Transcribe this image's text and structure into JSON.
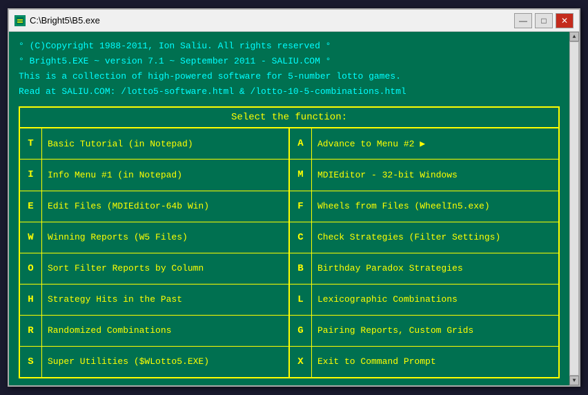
{
  "window": {
    "title": "C:\\Bright5\\B5.exe"
  },
  "titlebar": {
    "minimize": "—",
    "maximize": "□",
    "close": "✕"
  },
  "header": {
    "line1": "° (C)Copyright 1988-2011, Ion Saliu. All rights reserved °",
    "line2": "° Bright5.EXE ~ version 7.1 ~ September 2011 - SALIU.COM °",
    "line3": "This is a collection of high-powered software for 5-number lotto games.",
    "line4": "Read at SALIU.COM: /lotto5-software.html & /lotto-10-5-combinations.html"
  },
  "menu": {
    "title": "Select the function:",
    "rows": [
      {
        "left": {
          "key": "T",
          "label": "Basic Tutorial (in Notepad)"
        },
        "right": {
          "key": "A",
          "label": "Advance to Menu #2 ▶"
        }
      },
      {
        "left": {
          "key": "I",
          "label": "Info Menu #1 (in Notepad)"
        },
        "right": {
          "key": "M",
          "label": "MDIEditor - 32-bit Windows"
        }
      },
      {
        "left": {
          "key": "E",
          "label": "Edit Files (MDIEditor-64b Win)"
        },
        "right": {
          "key": "F",
          "label": "Wheels from Files (WheelIn5.exe)"
        }
      },
      {
        "left": {
          "key": "W",
          "label": "Winning Reports (W5 Files)"
        },
        "right": {
          "key": "C",
          "label": "Check Strategies (Filter Settings)"
        }
      },
      {
        "left": {
          "key": "O",
          "label": "Sort Filter Reports by Column"
        },
        "right": {
          "key": "B",
          "label": "Birthday Paradox Strategies"
        }
      },
      {
        "left": {
          "key": "H",
          "label": "Strategy Hits in the Past"
        },
        "right": {
          "key": "L",
          "label": "Lexicographic Combinations"
        }
      },
      {
        "left": {
          "key": "R",
          "label": "Randomized Combinations"
        },
        "right": {
          "key": "G",
          "label": "Pairing Reports, Custom Grids"
        }
      },
      {
        "left": {
          "key": "S",
          "label": "Super Utilities ($WLotto5.EXE)"
        },
        "right": {
          "key": "X",
          "label": "Exit to Command Prompt"
        }
      }
    ]
  }
}
